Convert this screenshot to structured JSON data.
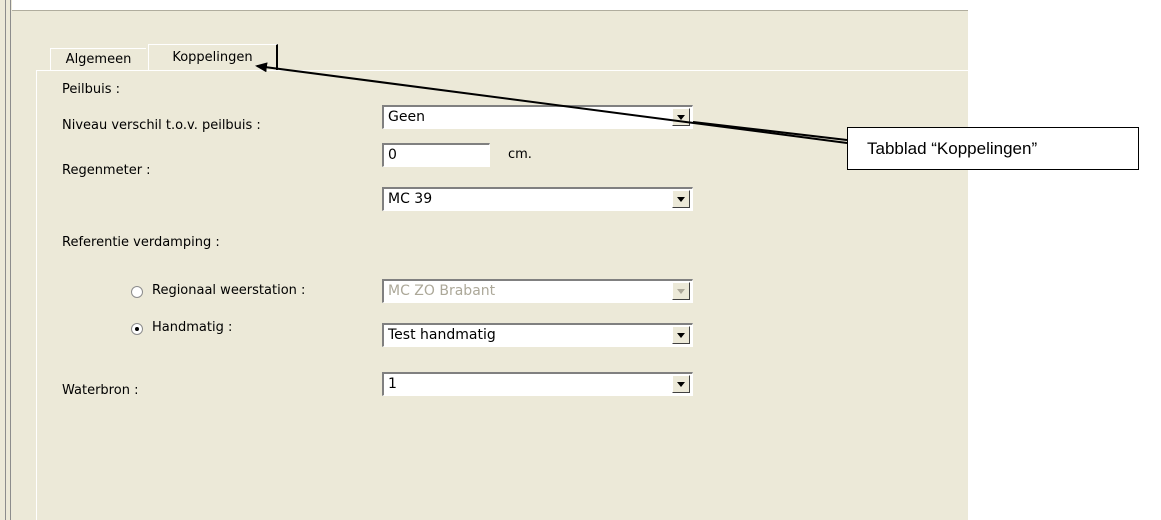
{
  "tabs": [
    {
      "label": "Algemeen",
      "active": false
    },
    {
      "label": "Koppelingen",
      "active": true
    }
  ],
  "form": {
    "peilbuis": {
      "label": "Peilbuis :",
      "value": "Geen"
    },
    "niveau": {
      "label": "Niveau verschil t.o.v. peilbuis :",
      "value": "0",
      "unit": "cm."
    },
    "regenmeter": {
      "label": "Regenmeter :",
      "value": "MC  39"
    },
    "referentie": {
      "label": "Referentie verdamping :"
    },
    "regionaal": {
      "label": "Regionaal weerstation :",
      "value": "MC ZO Brabant",
      "selected": false,
      "enabled": false
    },
    "handmatig": {
      "label": "Handmatig :",
      "value": "Test handmatig",
      "selected": true
    },
    "waterbron": {
      "label": "Waterbron :",
      "value": "1"
    }
  },
  "annotation": {
    "text": "Tabblad “Koppelingen”"
  },
  "icons": {
    "combo_button": "chevron-down-icon",
    "radio": "radio-button"
  }
}
